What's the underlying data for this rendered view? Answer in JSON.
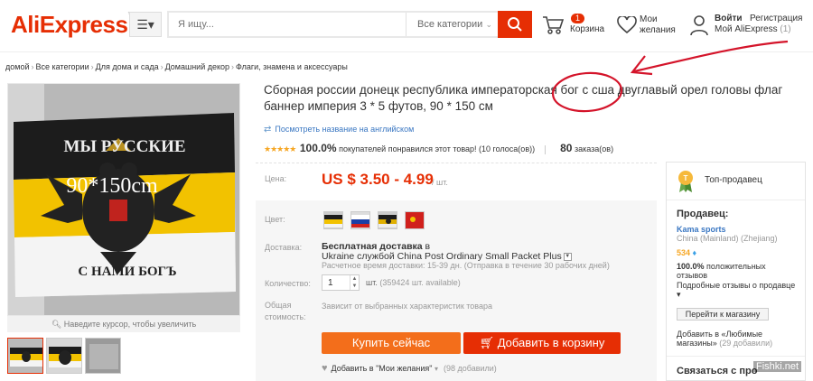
{
  "header": {
    "logo": "AliExpress",
    "logo_tm": "™",
    "search": {
      "placeholder": "Я ищу...",
      "categories": "Все категории"
    },
    "cart": {
      "count": "1",
      "label": "Корзина"
    },
    "wishlist": {
      "line1": "Мои",
      "line2": "желания"
    },
    "account": {
      "login": "Войти",
      "register": "Регистрация",
      "my": "Мой AliExpress",
      "count": "(1)"
    }
  },
  "breadcrumb": [
    "домой",
    "Все категории",
    "Для дома и сада",
    "Домашний декор",
    "Флаги, знамена и аксессуары"
  ],
  "gallery": {
    "flag_top": "МЫ РУССКИЕ",
    "flag_size": "90*150cm",
    "flag_bottom": "С НАМИ БОГЪ",
    "zoom_hint": "Наведите курсор, чтобы увеличить"
  },
  "product": {
    "title_before": "Сборная россии донецк республика императорская ",
    "title_highlight": "бог с сша",
    "title_after": " двуглавый орел головы флаг баннер империя 3 * 5 футов, 90 * 150 см",
    "view_english": "Посмотреть название на английском",
    "rating_pct": "100.0%",
    "rating_text": "покупателей понравился этот товар! (10 голоса(ов))",
    "orders": "80",
    "orders_label": "заказа(ов)",
    "price_label": "Цена:",
    "price": "US $ 3.50 - 4.99",
    "price_unit": "/ шт.",
    "color_label": "Цвет:",
    "shipping_label": "Доставка:",
    "shipping_free": "Бесплатная доставка",
    "shipping_in": " в",
    "shipping_line": "Ukraine службой China Post Ordinary Small Packet Plus",
    "shipping_time": "Расчетное время доставки: 15-39 дн. (Отправка в течение 30 рабочих дней)",
    "qty_label": "Количество:",
    "qty_value": "1",
    "qty_unit": "шт.",
    "qty_available": "(359424 шт. available)",
    "total_label_1": "Общая",
    "total_label_2": "стоимость:",
    "total_note": "Зависит от выбранных характеристик товара",
    "buy_now": "Купить сейчас",
    "add_to_cart": "Добавить в корзину",
    "add_wish": "Добавить в \"Мои желания\"",
    "wish_count": "(98 добавили)"
  },
  "seller": {
    "top_seller": "Топ-продавец",
    "label": "Продавец:",
    "store": "Kama sports",
    "location": "China (Mainland) (Zhejiang)",
    "score": "534",
    "positive_pct": "100.0%",
    "positive_text": "положительных отзывов",
    "reviews": "Подробные отзывы о продавце",
    "goto_store": "Перейти к магазину",
    "fav_text": "Добавить в «Любимые магазины»",
    "fav_count": "(29 добавили)",
    "contact": "Связаться с про"
  },
  "watermark": "Fishki.net",
  "colors": {
    "accent": "#e62e04",
    "buy": "#f36e1b",
    "link": "#3a77c2",
    "star": "#f6a623",
    "annotation": "#d4142a"
  }
}
